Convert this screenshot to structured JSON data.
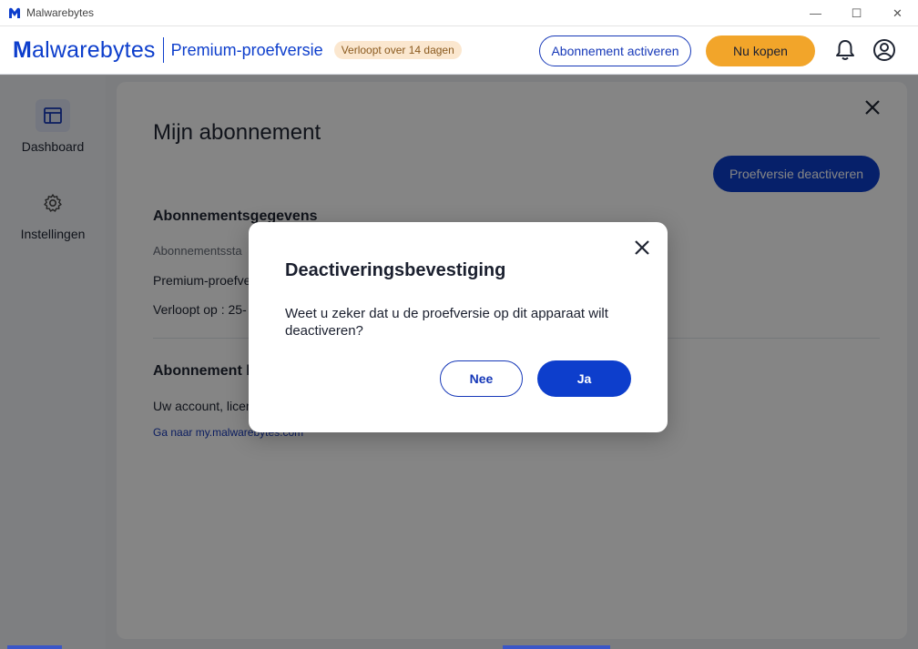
{
  "window": {
    "title": "Malwarebytes",
    "minimize_glyph": "—",
    "maximize_glyph": "☐",
    "close_glyph": "✕"
  },
  "header": {
    "logo_bold": "M",
    "logo_rest": "alwarebytes",
    "plan_name": "Premium-proefversie",
    "trial_badge": "Verloopt over 14 dagen",
    "activate_label": "Abonnement activeren",
    "buy_label": "Nu kopen"
  },
  "sidebar": {
    "items": [
      {
        "label": "Dashboard",
        "icon": "dashboard-icon",
        "active": true
      },
      {
        "label": "Instellingen",
        "icon": "gear-icon",
        "active": false
      }
    ]
  },
  "main": {
    "title": "Mijn abonnement",
    "deactivate_label": "Proefversie deactiveren",
    "details_heading": "Abonnementsgegevens",
    "status_label": "Abonnementssta",
    "status_value": "Premium-proefve",
    "expires_label": "Verloopt op : 25-",
    "manage_heading": "Abonnement b",
    "manage_text": "Uw account, licen",
    "manage_link": "Ga naar my.malwarebytes.com"
  },
  "dialog": {
    "title": "Deactiveringsbevestiging",
    "message": "Weet u zeker dat u de proefversie op dit apparaat wilt deactiveren?",
    "no_label": "Nee",
    "yes_label": "Ja"
  },
  "colors": {
    "brand": "#0d3ecc",
    "buy": "#f2a52a",
    "badge_bg": "#fbe7cf",
    "overlay": "rgba(0,0,0,0.48)"
  }
}
